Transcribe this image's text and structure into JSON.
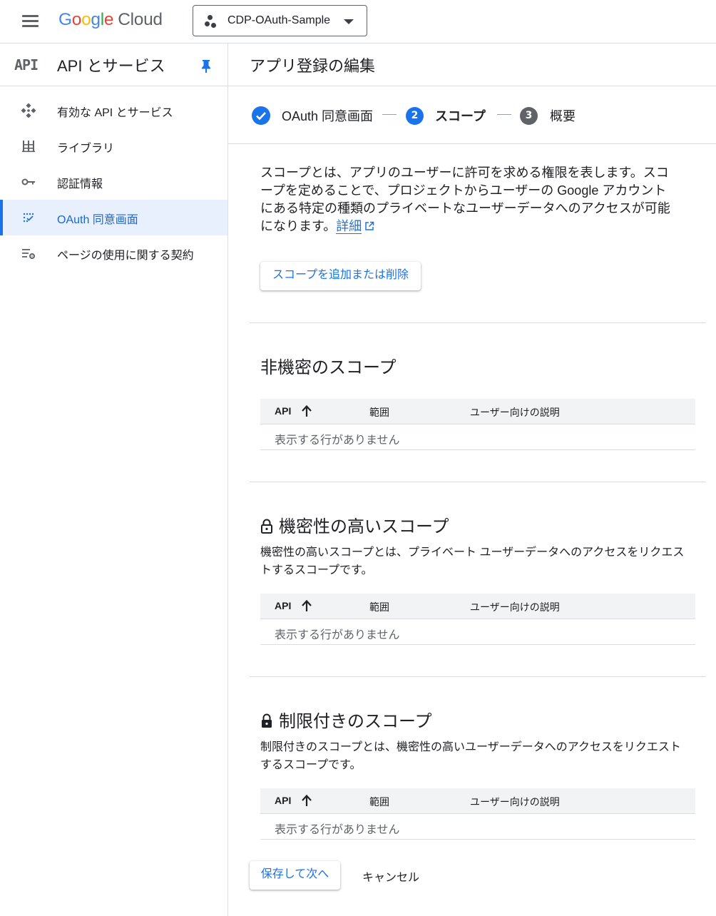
{
  "header": {
    "logo_letters": [
      "G",
      "o",
      "o",
      "g",
      "l",
      "e"
    ],
    "logo_product": "Cloud",
    "project_name": "CDP-OAuth-Sample"
  },
  "sidebar": {
    "icon_text": "API",
    "title": "API とサービス",
    "items": [
      {
        "label": "有効な API とサービス",
        "icon": "api-hub-icon",
        "active": false
      },
      {
        "label": "ライブラリ",
        "icon": "library-icon",
        "active": false
      },
      {
        "label": "認証情報",
        "icon": "key-icon",
        "active": false
      },
      {
        "label": "OAuth 同意画面",
        "icon": "consent-icon",
        "active": true
      },
      {
        "label": "ページの使用に関する契約",
        "icon": "settings-list-icon",
        "active": false
      }
    ]
  },
  "main": {
    "title": "アプリ登録の編集",
    "steps": [
      {
        "number": "",
        "label": "OAuth 同意画面",
        "state": "done"
      },
      {
        "number": "2",
        "label": "スコープ",
        "state": "current"
      },
      {
        "number": "3",
        "label": "概要",
        "state": "pending"
      }
    ],
    "intro_lines": [
      "スコープとは、アプリのユーザーに許可を求める権限を表します。スコ",
      "ープを定めることで、プロジェクトからユーザーの Google アカウント",
      "にある特定の種類のプライベートなユーザーデータへのアクセスが可能",
      "になります。"
    ],
    "details_link": "詳細",
    "add_scope_button": "スコープを追加または削除",
    "table_columns": [
      "API",
      "範囲",
      "ユーザー向けの説明"
    ],
    "sections": [
      {
        "title": "非機密のスコープ",
        "description_lines": [],
        "empty_text": "表示する行がありません"
      },
      {
        "title": "機密性の高いスコープ",
        "description_lines": [
          "機密性の高いスコープとは、プライベート ユーザーデータへのアクセスをリクエス",
          "トするスコープです。"
        ],
        "empty_text": "表示する行がありません"
      },
      {
        "title": "制限付きのスコープ",
        "description_lines": [
          "制限付きのスコープとは、機密性の高いユーザーデータへのアクセスをリクエスト",
          "するスコープです。"
        ],
        "empty_text": "表示する行がありません"
      }
    ],
    "save_button": "保存して次へ",
    "cancel_button": "キャンセル"
  },
  "colors": {
    "accent": "#1a73e8",
    "active_bg": "#e8f0fe",
    "step_pending": "#5f6368"
  }
}
